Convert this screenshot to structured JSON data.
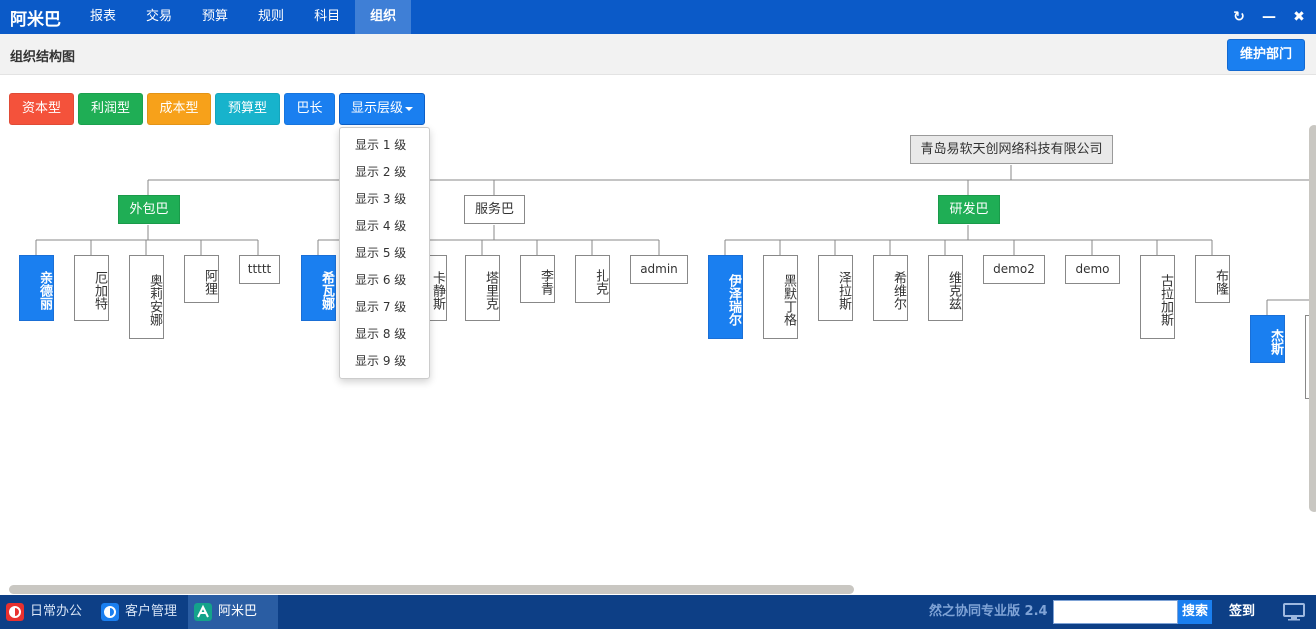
{
  "app": {
    "brand": "阿米巴"
  },
  "nav": [
    {
      "label": "报表",
      "active": false
    },
    {
      "label": "交易",
      "active": false
    },
    {
      "label": "预算",
      "active": false
    },
    {
      "label": "规则",
      "active": false
    },
    {
      "label": "科目",
      "active": false
    },
    {
      "label": "组织",
      "active": true
    }
  ],
  "window_controls": {
    "refresh": "↻",
    "minimize": "—",
    "close": "✖"
  },
  "page": {
    "title": "组织结构图",
    "maintain_button": "维护部门"
  },
  "legend": [
    {
      "label": "资本型",
      "color": "#f4523b"
    },
    {
      "label": "利润型",
      "color": "#1fae55"
    },
    {
      "label": "成本型",
      "color": "#f7a11a"
    },
    {
      "label": "预算型",
      "color": "#17b3cc"
    },
    {
      "label": "巴长",
      "color": "#1a7ff0"
    }
  ],
  "level_dropdown": {
    "label": "显示层级",
    "options": [
      "显示 1 级",
      "显示 2 级",
      "显示 3 级",
      "显示 4 级",
      "显示 5 级",
      "显示 6 级",
      "显示 7 级",
      "显示 8 级",
      "显示 9 级"
    ]
  },
  "org": {
    "root": "青岛易软天创网络科技有限公司",
    "groups": [
      {
        "name": "外包巴",
        "members": [
          "亲德丽",
          "厄加特",
          "奥莉安娜",
          "阿狸",
          "ttttt"
        ]
      },
      {
        "name": "服务巴",
        "members": [
          "希瓦娜",
          "",
          "卡静斯",
          "塔里克",
          "李青",
          "扎克",
          "admin"
        ]
      },
      {
        "name": "研发巴",
        "members": [
          "伊泽瑞尔",
          "黑默丁格",
          "泽拉斯",
          "希维尔",
          "维克兹",
          "demo2",
          "demo",
          "古拉加斯",
          "布隆"
        ]
      }
    ],
    "extra": "杰斯"
  },
  "colors": {
    "accent": "#1a7ff0",
    "nav_bg": "#0b5ac8",
    "taskbar_bg": "#0d3f86",
    "profit_green": "#1fae55"
  },
  "taskbar": {
    "tasks": [
      {
        "label": "日常办公",
        "icon": "daily-office-icon",
        "active": false
      },
      {
        "label": "客户管理",
        "icon": "crm-icon",
        "active": false
      },
      {
        "label": "阿米巴",
        "icon": "amoeba-icon",
        "active": true
      }
    ],
    "version": "然之协同专业版 2.4",
    "search_placeholder": "",
    "search_button": "搜索",
    "signin": "签到"
  }
}
